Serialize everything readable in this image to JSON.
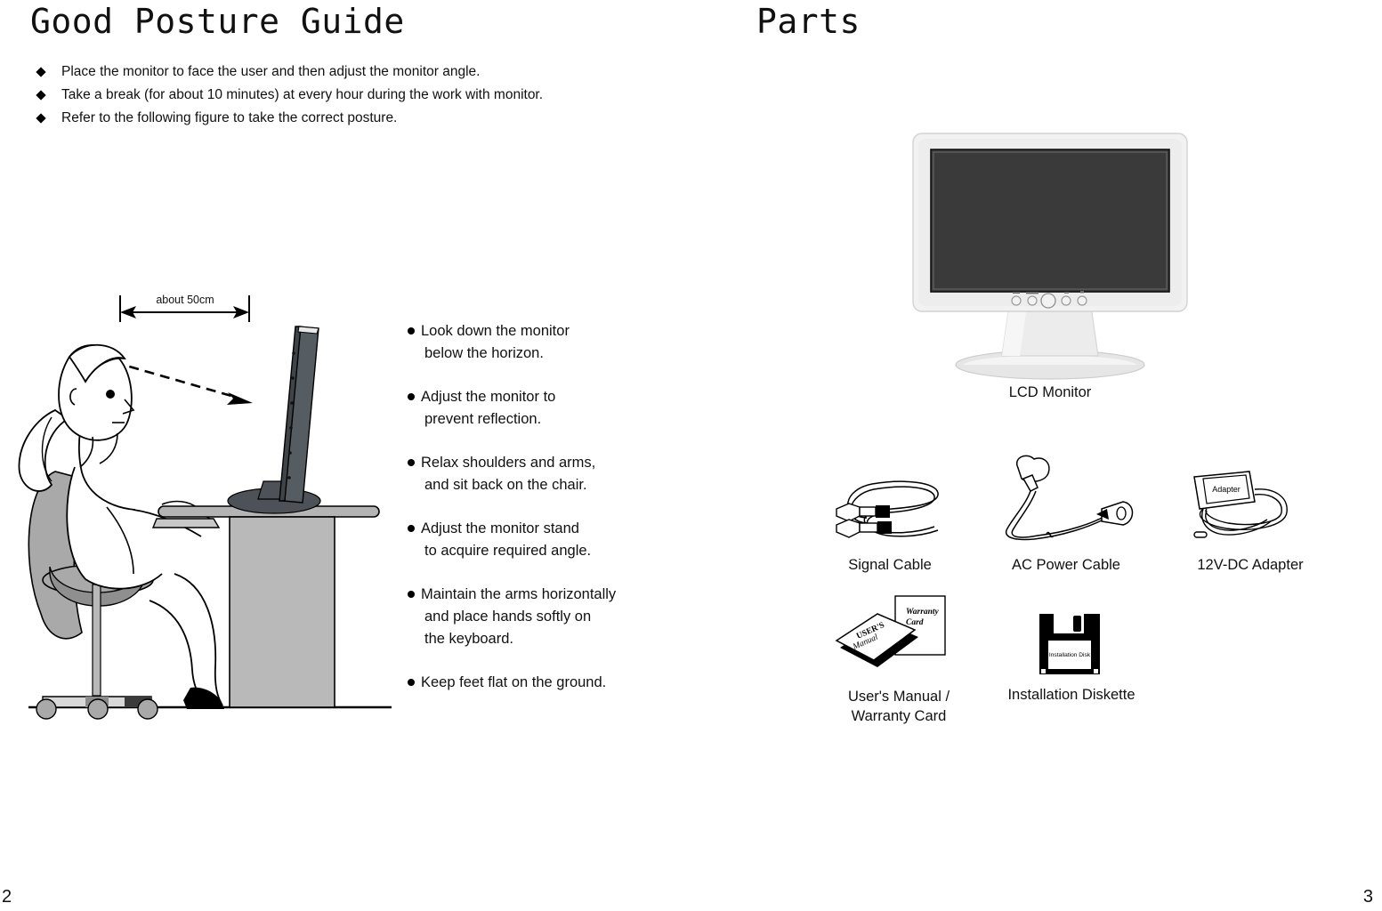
{
  "left_page": {
    "heading": "Good Posture Guide",
    "page_number": "2",
    "guidelines": [
      "Place the monitor to face the user and then adjust the monitor angle.",
      "Take a break (for about 10 minutes) at every hour during the work with monitor.",
      "Refer to the following figure to take the correct posture."
    ],
    "dimension_label": "about 50cm",
    "posture_notes": [
      {
        "line1": "Look down the monitor",
        "line2": "below the horizon.",
        "line3": ""
      },
      {
        "line1": "Adjust the monitor to",
        "line2": "prevent reflection.",
        "line3": ""
      },
      {
        "line1": "Relax shoulders and arms,",
        "line2": "and sit back on the chair.",
        "line3": ""
      },
      {
        "line1": "Adjust the monitor stand",
        "line2": "to acquire required angle.",
        "line3": ""
      },
      {
        "line1": "Maintain the arms horizontally",
        "line2": "and place hands softly on",
        "line3": "the keyboard."
      },
      {
        "line1": "Keep feet flat on the ground.",
        "line2": "",
        "line3": ""
      }
    ]
  },
  "right_page": {
    "heading": "Parts",
    "page_number": "3",
    "monitor": {
      "caption": "LCD Monitor"
    },
    "accessories_row1": [
      {
        "caption": "Signal Cable"
      },
      {
        "caption": "AC Power Cable"
      },
      {
        "caption": "12V-DC Adapter",
        "device_label": "Adapter"
      }
    ],
    "accessories_row2": [
      {
        "caption_line1": "User's Manual /",
        "caption_line2": "Warranty Card",
        "book_label_line1": "USER'S",
        "book_label_line2": "Manual",
        "card_label_line1": "Warranty",
        "card_label_line2": "Card"
      },
      {
        "caption_line1": "Installation Diskette",
        "caption_line2": "",
        "disk_label": "Installation Disk"
      }
    ]
  },
  "colors": {
    "ink": "#111111",
    "bezel_light": "#f2f2f2",
    "bezel_shade": "#dcdcdc",
    "screen_dark": "#3a3a3a",
    "desk_gray": "#b4b4b4",
    "chair_gray": "#9c9c9c",
    "monitor_side": "#4c5257"
  }
}
